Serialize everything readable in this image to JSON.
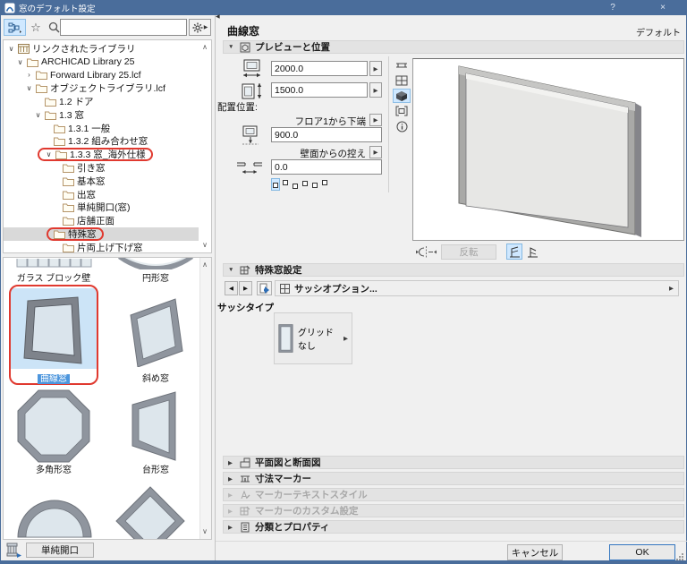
{
  "window": {
    "title": "窓のデフォルト設定",
    "help_button": "?",
    "close_button": "×"
  },
  "icons": {
    "expand": "∨",
    "collapse": "›",
    "scroll_up": "∧",
    "scroll_down": "∨",
    "star": "☆",
    "flyout": "▶",
    "section_open": "▼",
    "section_closed": "▶",
    "panel_collapse": "◀",
    "left_arrow": "◀",
    "right_arrow": "▶"
  },
  "left": {
    "search": {
      "value": "",
      "placeholder": ""
    },
    "tree": {
      "items": [
        {
          "label": "リンクされたライブラリ"
        },
        {
          "label": "ARCHICAD Library 25"
        },
        {
          "label": "Forward Library 25.lcf"
        },
        {
          "label": "オブジェクトライブラリ.lcf"
        },
        {
          "label": "1.2 ドア"
        },
        {
          "label": "1.3 窓"
        },
        {
          "label": "1.3.1 一般"
        },
        {
          "label": "1.3.2 組み合わせ窓"
        },
        {
          "label": "1.3.3 窓_海外仕様",
          "annotated": true
        },
        {
          "label": "引き窓"
        },
        {
          "label": "基本窓"
        },
        {
          "label": "出窓"
        },
        {
          "label": "単純開口(窓)"
        },
        {
          "label": "店舗正面"
        },
        {
          "label": "特殊窓",
          "selected": true,
          "annotated": true
        },
        {
          "label": "片両上げ下げ窓"
        }
      ]
    },
    "thumbnails": {
      "items": [
        {
          "label": "ガラス ブロック壁"
        },
        {
          "label": "円形窓"
        },
        {
          "label": "曲線窓",
          "selected": true,
          "annotated": true
        },
        {
          "label": "斜め窓"
        },
        {
          "label": "多角形窓"
        },
        {
          "label": "台形窓"
        }
      ]
    },
    "simple_opening_button": "単純開口"
  },
  "right": {
    "object_title": "曲線窓",
    "default_label": "デフォルト",
    "preview_section": {
      "title": "プレビューと位置",
      "width_value": "2000.0",
      "height_value": "1500.0",
      "placement_label": "配置位置:",
      "anchor_ref_label": "フロア1から下端",
      "anchor_value": "900.0",
      "reveal_label": "壁面からの控え",
      "reveal_value": "0.0",
      "flip_button": "反転"
    },
    "special_section": {
      "title": "特殊窓設定",
      "sash_options_button": "サッシオプション...",
      "sash_type_label": "サッシタイプ",
      "sash_type_value": "グリッドなし"
    },
    "collapsed_sections": [
      {
        "label": "平面図と断面図",
        "enabled": true
      },
      {
        "label": "寸法マーカー",
        "enabled": true
      },
      {
        "label": "マーカーテキストスタイル",
        "enabled": false
      },
      {
        "label": "マーカーのカスタム設定",
        "enabled": false
      },
      {
        "label": "分類とプロパティ",
        "enabled": true
      }
    ]
  },
  "footer": {
    "cancel_button": "キャンセル",
    "ok_button": "OK"
  },
  "colors": {
    "titlebar": "#4a6d9b",
    "annotation_red": "#e0392f",
    "selection_blue": "#cce4f7",
    "thumb_selection": "#4d96dd"
  }
}
